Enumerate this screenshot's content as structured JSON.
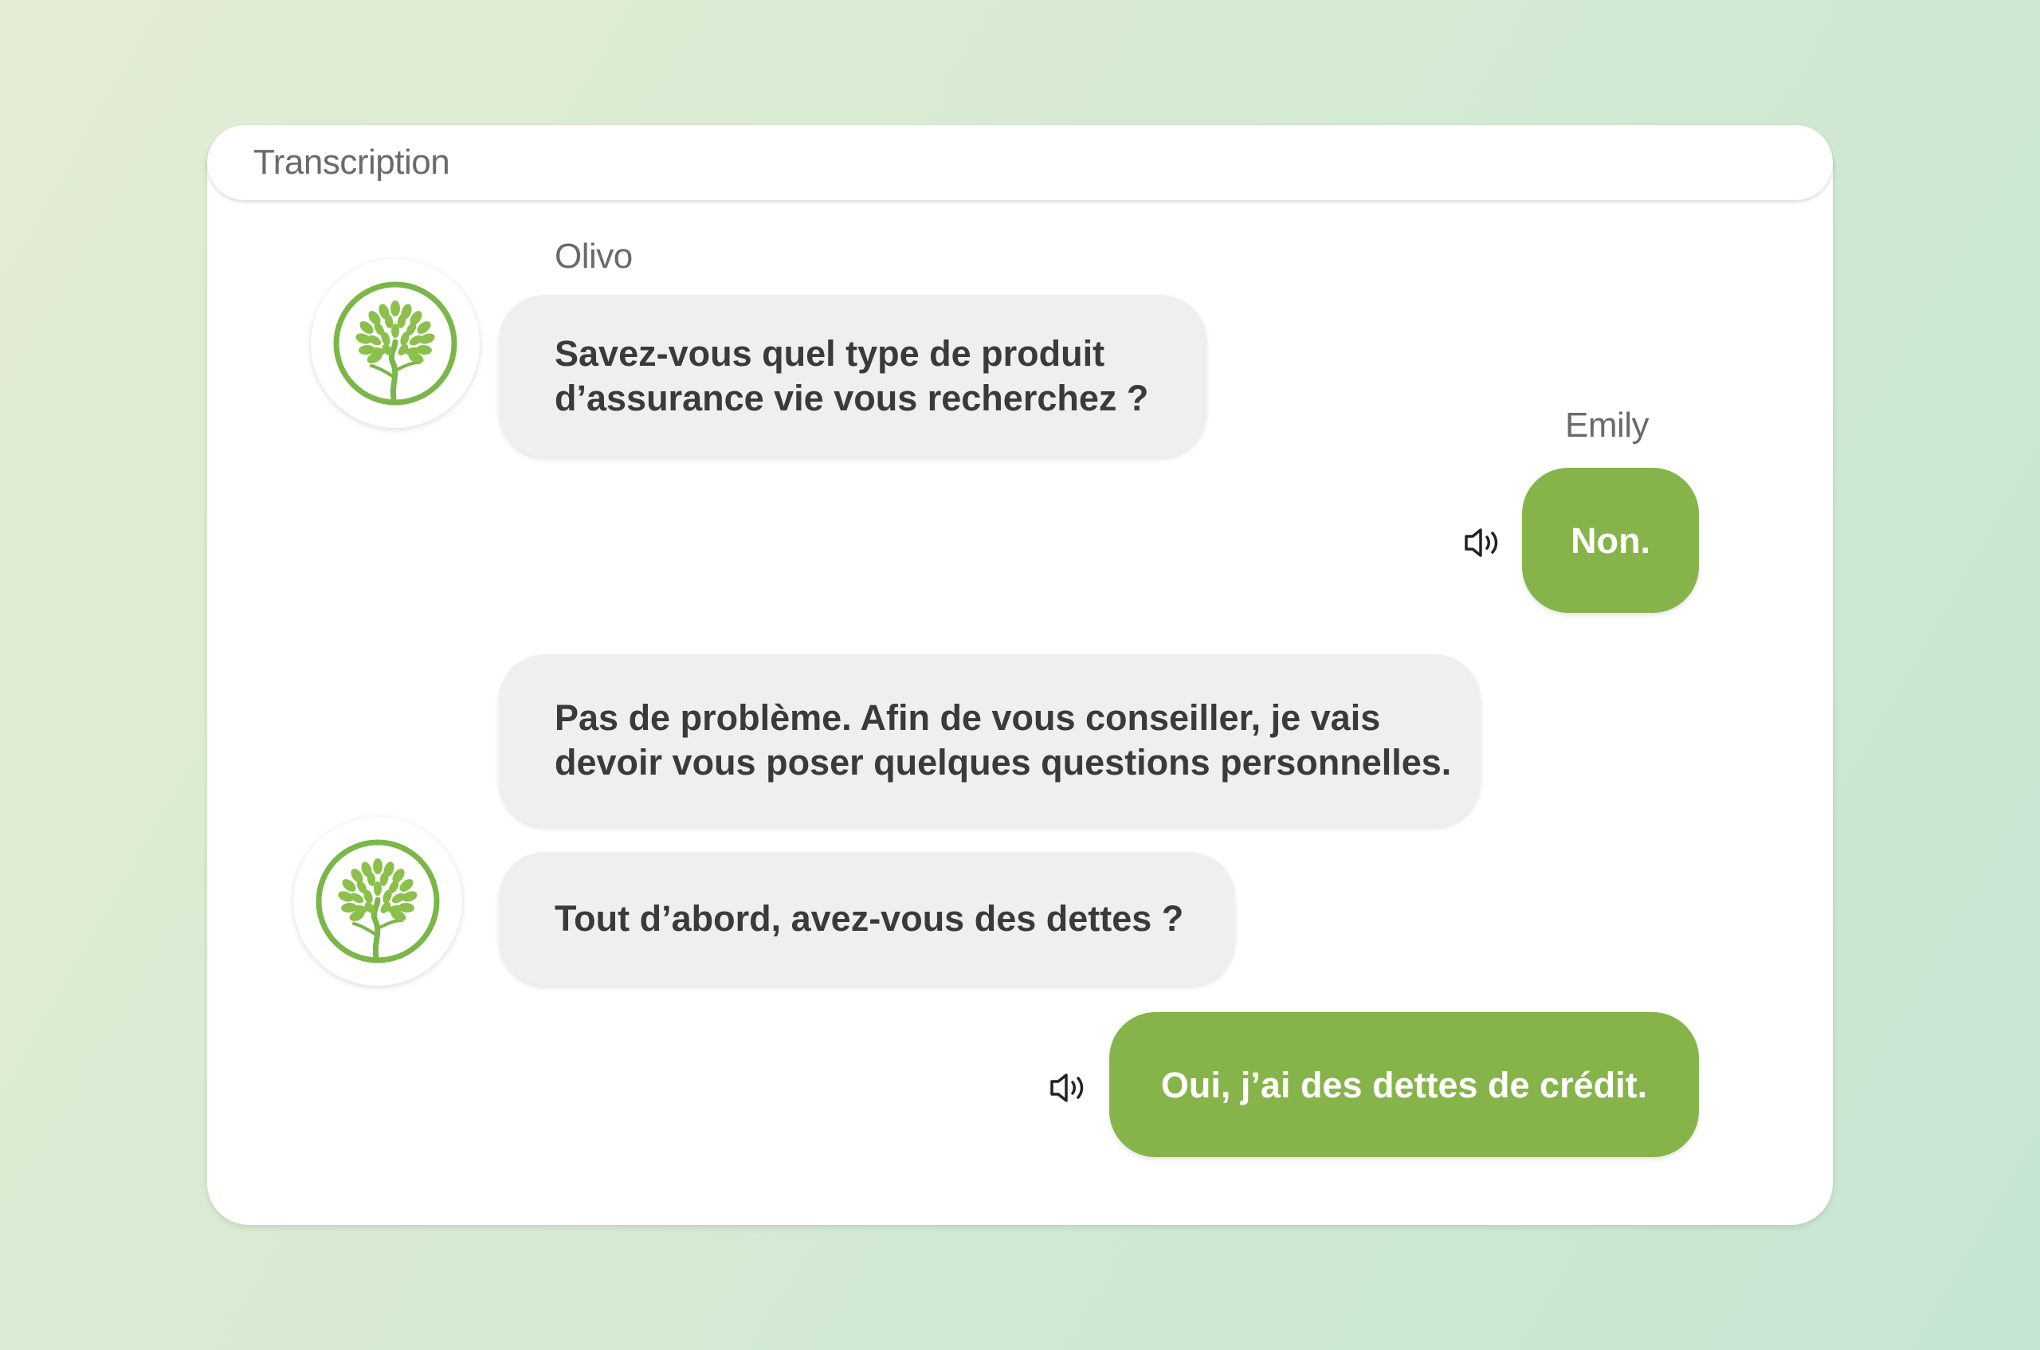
{
  "panel": {
    "title": "Transcription"
  },
  "conversation": {
    "bot_name": "Olivo",
    "user_name": "Emily",
    "messages": [
      {
        "speaker": "bot",
        "lines": [
          "Savez-vous quel type de produit",
          "d’assurance vie vous recherchez ?"
        ]
      },
      {
        "speaker": "user",
        "lines": [
          "Non."
        ]
      },
      {
        "speaker": "bot",
        "lines": [
          "Pas de problème. Afin de vous conseiller, je vais",
          "devoir vous poser quelques questions personnelles."
        ]
      },
      {
        "speaker": "bot",
        "lines": [
          "Tout d’abord, avez-vous des dettes ?"
        ]
      },
      {
        "speaker": "user",
        "lines": [
          "Oui, j’ai des dettes de crédit."
        ]
      }
    ]
  },
  "icons": {
    "bot_avatar": "tree-logo-icon",
    "audio": "speaker-icon"
  },
  "colors": {
    "accent_green": "#87b44a",
    "bot_bubble": "#efefef",
    "logo_green": "#7ab648"
  }
}
